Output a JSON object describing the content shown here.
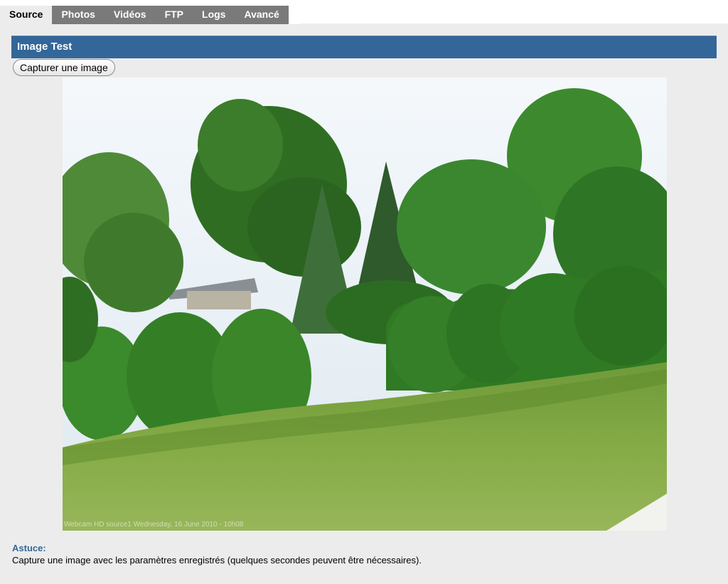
{
  "tabs": [
    {
      "label": "Source",
      "active": true
    },
    {
      "label": "Photos",
      "active": false
    },
    {
      "label": "Vidéos",
      "active": false
    },
    {
      "label": "FTP",
      "active": false
    },
    {
      "label": "Logs",
      "active": false
    },
    {
      "label": "Avancé",
      "active": false
    }
  ],
  "section": {
    "title": "Image Test",
    "capture_button": "Capturer une image"
  },
  "snapshot": {
    "caption": "Webcam HD source1 Wednesday, 16 June 2010 - 10h08"
  },
  "tip": {
    "title": "Astuce:",
    "text": "Capture une image avec les paramètres enregistrés (quelques secondes peuvent être nécessaires)."
  },
  "colors": {
    "header_bg": "#336699",
    "panel_bg": "#ececec",
    "tab_bg": "#7a7a7a",
    "tip_title": "#336699"
  }
}
